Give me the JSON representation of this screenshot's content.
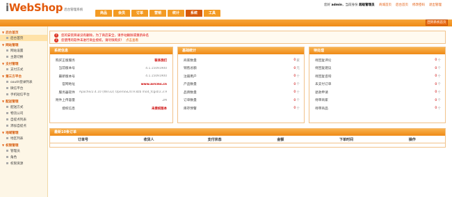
{
  "app": {
    "logo_prefix": "i",
    "logo_main": "WebShop",
    "logo_sub": "后台管理系统"
  },
  "nav": {
    "tabs": [
      "商品",
      "会员",
      "订单",
      "营销",
      "统计",
      "系统",
      "工具"
    ],
    "active_index": 5
  },
  "topbar": {
    "welcome": "您好",
    "user": "admin",
    "role_prefix": "，当前身份",
    "role": "超级管理员",
    "links": [
      "商城首页",
      "后台首页",
      "修改密码",
      "退出管理"
    ],
    "back_button": "回到系统首页"
  },
  "sidebar": [
    {
      "group": "后台首页",
      "items": [
        "后台首页"
      ]
    },
    {
      "group": "网站管理",
      "items": [
        "网站设置",
        "主题切换"
      ]
    },
    {
      "group": "支付管理",
      "items": [
        "支付方式"
      ]
    },
    {
      "group": "第三方平台",
      "items": [
        "oauth登录列表",
        "微信平台",
        "手机短信平台"
      ]
    },
    {
      "group": "配送管理",
      "items": [
        "配送方式",
        "物流公司",
        "自提点列表",
        "添加自提点"
      ]
    },
    {
      "group": "地域管理",
      "items": [
        "地区列表"
      ]
    },
    {
      "group": "权限管理",
      "items": [
        "管理员",
        "角色",
        "权限资源"
      ]
    }
  ],
  "alerts": [
    {
      "text": "您的安装目录没有删除，为了商店安全，请手动删除或重新命名",
      "link": ""
    },
    {
      "text": "您使用的软件未进行商业授权，请尽快购买！",
      "link": "点击查看"
    }
  ],
  "system_panel": {
    "title": "系统信息",
    "rows": [
      {
        "label": "购买正版服务",
        "value": "联系我们",
        "red": true
      },
      {
        "label": "当前版本号",
        "value": "4.1.15091900",
        "red": false
      },
      {
        "label": "最新版本号",
        "value": "4.1.15091900",
        "red": false
      },
      {
        "label": "官网地址",
        "value": "www.aircms.cn",
        "red": true
      },
      {
        "label": "服务器软件",
        "value": "Apache/2.4.10 (Win32) OpenSSL/0.9.8zb mod_fcgid/2.3.9",
        "red": false
      },
      {
        "label": "附件上传容量",
        "value": "2M",
        "red": false
      },
      {
        "label": "授权信息",
        "value": "未授权版本",
        "red": true
      }
    ]
  },
  "stats_panel": {
    "title": "基础统计",
    "rows": [
      {
        "label": "商家数量",
        "value": "0",
        "unit": "家"
      },
      {
        "label": "销售总额",
        "value": "0",
        "unit": "元"
      },
      {
        "label": "注册用户",
        "value": "0",
        "unit": "个"
      },
      {
        "label": "产品数量",
        "value": "0",
        "unit": "个"
      },
      {
        "label": "品牌数量",
        "value": "0",
        "unit": "个"
      },
      {
        "label": "订单数量",
        "value": "0",
        "unit": "个"
      },
      {
        "label": "库存预警",
        "value": "0",
        "unit": "个"
      }
    ]
  },
  "pending_panel": {
    "title": "待处理",
    "rows": [
      {
        "label": "待回复评论",
        "value": "0",
        "unit": "个"
      },
      {
        "label": "待回复建议",
        "value": "0",
        "unit": "个"
      },
      {
        "label": "待回复咨询",
        "value": "0",
        "unit": "个"
      },
      {
        "label": "未支付订单",
        "value": "0",
        "unit": "个"
      },
      {
        "label": "退款申请",
        "value": "0",
        "unit": "个"
      },
      {
        "label": "待审商家",
        "value": "0",
        "unit": "个"
      },
      {
        "label": "待审商品",
        "value": "0",
        "unit": "个"
      }
    ]
  },
  "orders_panel": {
    "title": "最新10条订单",
    "columns": [
      "订单号",
      "收货人",
      "支付状态",
      "金额",
      "下单时间",
      "操作"
    ]
  },
  "colors": {
    "brand": "#e35a0c",
    "accent": "#f39b24"
  }
}
